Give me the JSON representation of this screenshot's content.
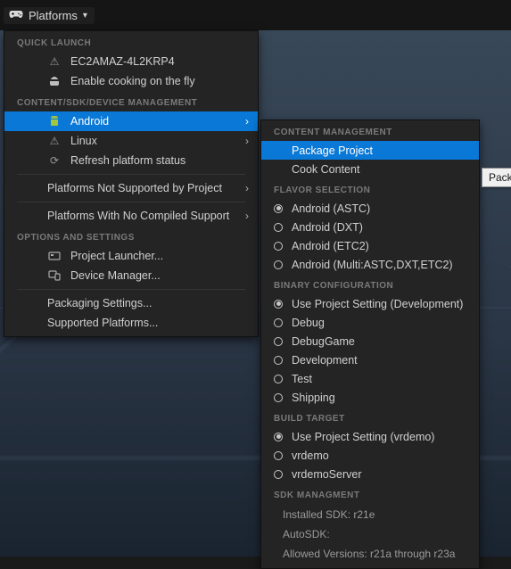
{
  "toolbar": {
    "platforms_label": "Platforms"
  },
  "menu": {
    "sections": {
      "quick_launch": "QUICK LAUNCH",
      "content_sdk": "CONTENT/SDK/DEVICE MANAGEMENT",
      "options": "OPTIONS AND SETTINGS"
    },
    "quick_launch": {
      "device": "EC2AMAZ-4L2KRP4",
      "cook_fly": "Enable cooking on the fly"
    },
    "sdk": {
      "android": "Android",
      "linux": "Linux",
      "refresh": "Refresh platform status",
      "not_supported": "Platforms Not Supported by Project",
      "no_compiled": "Platforms With No Compiled Support"
    },
    "options": {
      "launcher": "Project Launcher...",
      "device_mgr": "Device Manager...",
      "packaging": "Packaging Settings...",
      "supported": "Supported Platforms..."
    }
  },
  "submenu": {
    "headers": {
      "content_mgmt": "CONTENT MANAGEMENT",
      "flavor": "FLAVOR SELECTION",
      "binary": "BINARY CONFIGURATION",
      "build_target": "BUILD TARGET",
      "sdk": "SDK MANAGMENT"
    },
    "content": {
      "package": "Package Project",
      "cook": "Cook Content"
    },
    "flavors": {
      "astc": "Android (ASTC)",
      "dxt": "Android (DXT)",
      "etc2": "Android (ETC2)",
      "multi": "Android (Multi:ASTC,DXT,ETC2)"
    },
    "binary": {
      "dev_setting": "Use Project Setting (Development)",
      "debug": "Debug",
      "debuggame": "DebugGame",
      "development": "Development",
      "test": "Test",
      "shipping": "Shipping"
    },
    "targets": {
      "setting": "Use Project Setting (vrdemo)",
      "vrdemo": "vrdemo",
      "vrdemoserver": "vrdemoServer"
    },
    "sdk_info": {
      "installed": "Installed SDK: r21e",
      "auto": "AutoSDK:",
      "allowed": "Allowed Versions: r21a through r23a"
    }
  },
  "tooltip": "Pack"
}
